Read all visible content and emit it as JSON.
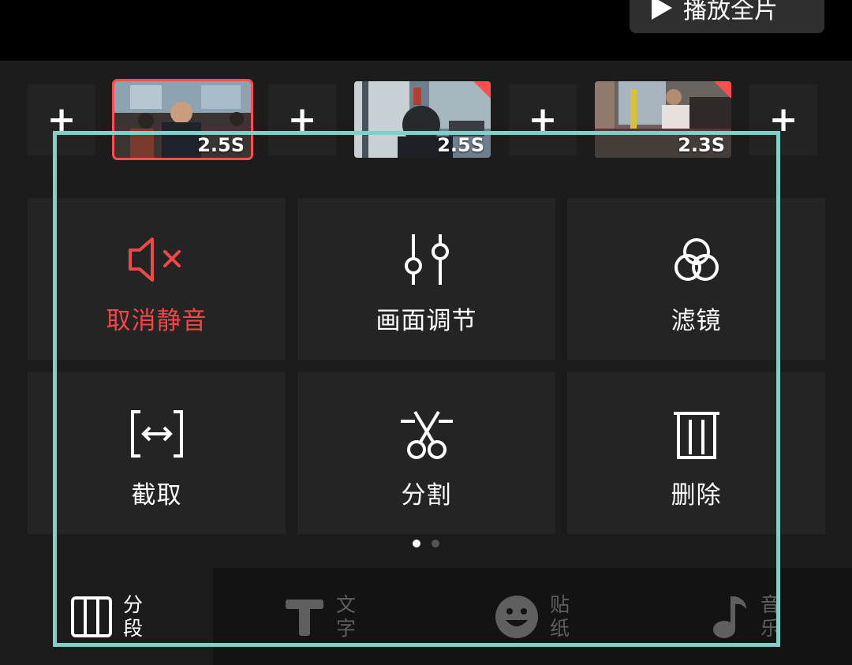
{
  "header": {
    "play_all_label": "播放全片"
  },
  "timeline": {
    "clips": [
      {
        "duration": "2.5S",
        "selected": true
      },
      {
        "duration": "2.5S",
        "selected": false
      },
      {
        "duration": "2.3S",
        "selected": false
      }
    ],
    "add_symbol": "+"
  },
  "actions": [
    {
      "label": "取消静音",
      "icon": "speaker-mute-icon",
      "color": "#f04747"
    },
    {
      "label": "画面调节",
      "icon": "sliders-icon"
    },
    {
      "label": "滤镜",
      "icon": "filter-circles-icon"
    },
    {
      "label": "截取",
      "icon": "crop-trim-icon"
    },
    {
      "label": "分割",
      "icon": "scissors-split-icon"
    },
    {
      "label": "删除",
      "icon": "trash-icon"
    }
  ],
  "pager": {
    "pages": 2,
    "active": 1
  },
  "bottom_nav": [
    {
      "line1": "分",
      "line2": "段",
      "icon": "segment-icon",
      "active": true
    },
    {
      "line1": "文",
      "line2": "字",
      "icon": "text-icon",
      "active": false
    },
    {
      "line1": "贴",
      "line2": "纸",
      "icon": "sticker-icon",
      "active": false
    },
    {
      "line1": "音",
      "line2": "乐",
      "icon": "music-icon",
      "active": false
    }
  ],
  "colors": {
    "accent_red": "#f04747",
    "highlight": "#7fd1c7",
    "background": "#1b1b1b",
    "panel": "#242424"
  }
}
